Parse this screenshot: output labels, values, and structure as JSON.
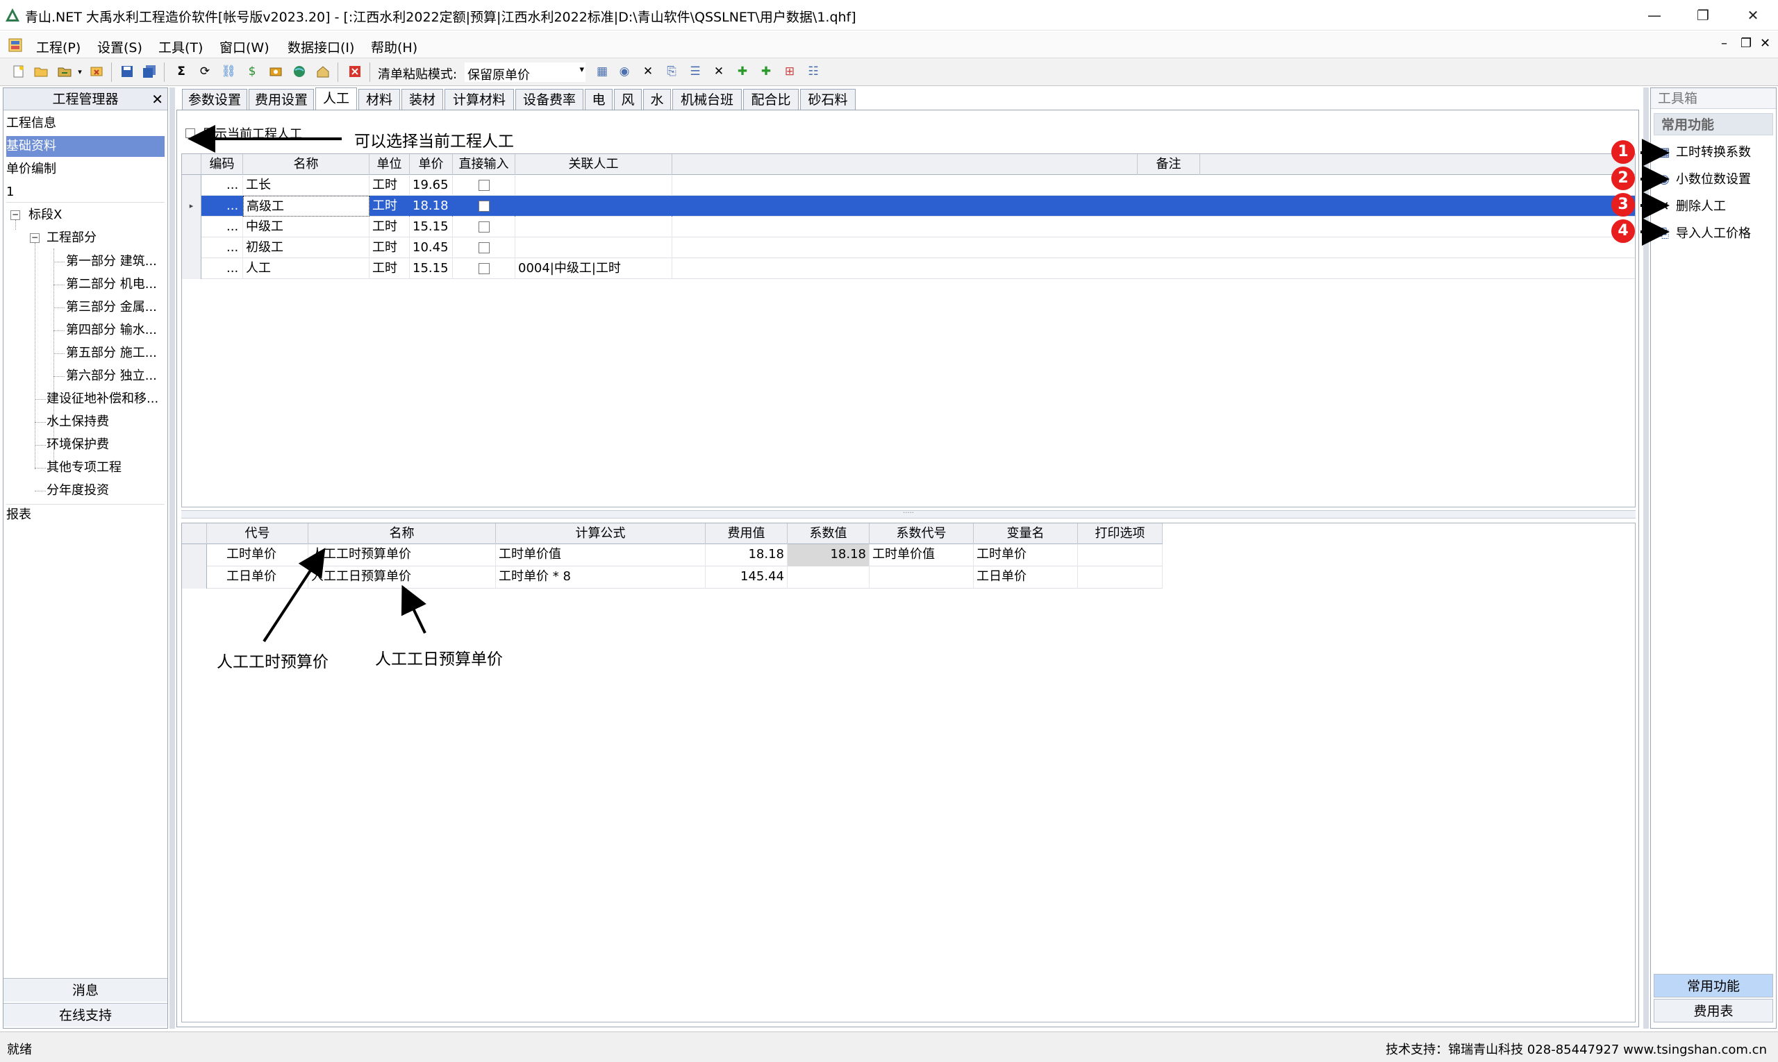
{
  "window": {
    "title": "青山.NET 大禹水利工程造价软件[帐号版v2023.20] - [:江西水利2022定额|预算|江西水利2022标准|D:\\青山软件\\QSSLNET\\用户数据\\1.qhf]",
    "min": "—",
    "restore": "❐",
    "close": "✕"
  },
  "menu": {
    "items": [
      "工程(P)",
      "设置(S)",
      "工具(T)",
      "窗口(W)",
      "数据接口(I)",
      "帮助(H)"
    ],
    "mdi": [
      "–",
      "❐",
      "✕"
    ]
  },
  "toolbar": {
    "paste_mode_label": "清单粘贴模式:",
    "paste_mode_value": "保留原单价"
  },
  "left_panel": {
    "title": "工程管理器",
    "close": "✕",
    "items": {
      "info": "工程信息",
      "basic": "基础资料",
      "unit_price": "单价编制",
      "one": "1",
      "section_x": "标段X",
      "engineering": "工程部分",
      "part1": "第一部分 建筑...",
      "part2": "第二部分 机电...",
      "part3": "第三部分 金属...",
      "part4": "第四部分 输水...",
      "part5": "第五部分 施工...",
      "part6": "第六部分 独立...",
      "land": "建设征地补偿和移...",
      "soil": "水土保持费",
      "env": "环境保护费",
      "other": "其他专项工程",
      "annual": "分年度投资",
      "report": "报表"
    },
    "bottom": {
      "messages": "消息",
      "online": "在线支持"
    }
  },
  "tabs": [
    "参数设置",
    "费用设置",
    "人工",
    "材料",
    "装材",
    "计算材料",
    "设备费率",
    "电",
    "风",
    "水",
    "机械台班",
    "配合比",
    "砂石料"
  ],
  "active_tab": "人工",
  "checkbox": {
    "label": "显示当前工程人工"
  },
  "labor_table": {
    "headers": [
      "编码",
      "名称",
      "单位",
      "单价",
      "直接输入",
      "关联人工",
      "备注"
    ],
    "rows": [
      {
        "code": "...",
        "name": "工长",
        "unit": "工时",
        "price": "19.65",
        "link": ""
      },
      {
        "code": "...",
        "name": "高级工",
        "unit": "工时",
        "price": "18.18",
        "link": ""
      },
      {
        "code": "...",
        "name": "中级工",
        "unit": "工时",
        "price": "15.15",
        "link": ""
      },
      {
        "code": "...",
        "name": "初级工",
        "unit": "工时",
        "price": "10.45",
        "link": ""
      },
      {
        "code": "...",
        "name": "人工",
        "unit": "工时",
        "price": "15.15",
        "link": "0004|中级工|工时"
      }
    ]
  },
  "detail_table": {
    "headers": [
      "代号",
      "名称",
      "计算公式",
      "费用值",
      "系数值",
      "系数代号",
      "变量名",
      "打印选项"
    ],
    "rows": [
      {
        "code": "工时单价",
        "name": "人工工时预算单价",
        "formula": "工时单价值",
        "value": "18.18",
        "coef": "18.18",
        "coef_code": "工时单价值",
        "var": "工时单价"
      },
      {
        "code": "工日单价",
        "name": "人工工日预算单价",
        "formula": "工时单价 * 8",
        "value": "145.44",
        "coef": "",
        "coef_code": "",
        "var": "工日单价"
      }
    ]
  },
  "annotations": {
    "select_labor": "可以选择当前工程人工",
    "hour_price": "人工工时预算价",
    "day_price": "人工工日预算单价",
    "badges": [
      "1",
      "2",
      "3",
      "4"
    ]
  },
  "right_panel": {
    "title": "工具箱",
    "section": "常用功能",
    "tools": [
      "工时转换系数",
      "小数位数设置",
      "删除人工",
      "导入人工价格"
    ],
    "bottom": [
      "常用功能",
      "费用表"
    ]
  },
  "status": {
    "left": "就绪",
    "right": "技术支持：锦瑞青山科技 028-85447927 www.tsingshan.com.cn"
  },
  "colors": {
    "selection": "#2c5fd0",
    "nav_selection": "#6e8fd6",
    "badge": "#e81e1e"
  }
}
